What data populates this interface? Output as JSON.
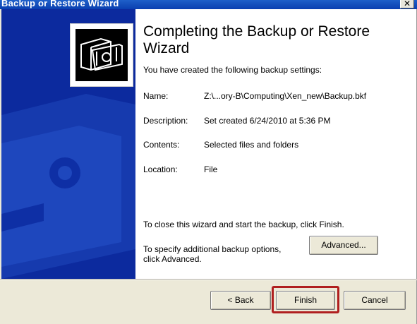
{
  "window": {
    "title": "Backup or Restore Wizard"
  },
  "main": {
    "heading": "Completing the Backup or Restore Wizard",
    "subheading": "You have created the following backup settings:",
    "settings": [
      {
        "label": "Name:",
        "value": "Z:\\...ory-B\\Computing\\Xen_new\\Backup.bkf"
      },
      {
        "label": "Description:",
        "value": "Set created 6/24/2010 at 5:36 PM"
      },
      {
        "label": "Contents:",
        "value": "Selected files and folders"
      },
      {
        "label": "Location:",
        "value": "File"
      }
    ],
    "finish_note": "To close this wizard and start the backup, click Finish.",
    "options_note_line1": "To specify additional backup options,",
    "options_note_line2": "click Advanced."
  },
  "buttons": {
    "advanced": "Advanced...",
    "back": "< Back",
    "finish": "Finish",
    "cancel": "Cancel"
  },
  "icons": {
    "wizard": "backup-tape-icon",
    "close": "close-icon"
  },
  "colors": {
    "side_panel": "#0c2a9e",
    "title_bar": "#0a3fb0",
    "highlight": "#b01f1f"
  }
}
